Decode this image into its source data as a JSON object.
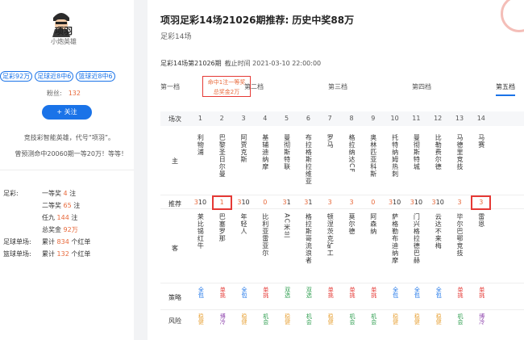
{
  "profile": {
    "nickname": "项羽",
    "subtitle": "小炮英雄",
    "tags": [
      "足彩92万",
      "足球近8中6",
      "篮球近8中6"
    ],
    "fans_label": "粉丝:",
    "fans_value": "132",
    "follow_label": "+ 关注",
    "desc_line1": "竞技彩智能英雄，代号“项羽”。",
    "desc_line2": "曾预测命中20060期一等20万！等等！",
    "stats": [
      {
        "label": "足彩:",
        "prefix": "一等奖",
        "num": "4",
        "suffix": "注"
      },
      {
        "label": "",
        "prefix": "二等奖",
        "num": "65",
        "suffix": "注"
      },
      {
        "label": "",
        "prefix": "任九",
        "num": "144",
        "suffix": "注"
      },
      {
        "label": "",
        "prefix": "总奖金",
        "num": "92万",
        "suffix": ""
      },
      {
        "label": "足球单场:",
        "prefix": "累计",
        "num": "834",
        "suffix": "个红单"
      },
      {
        "label": "篮球单场:",
        "prefix": "累计",
        "num": "132",
        "suffix": "个红单"
      }
    ]
  },
  "article": {
    "title": "项羽足彩14场21026期推荐: 历史中奖88万",
    "subtitle": "足彩14场",
    "issue": "足彩14场第21026期",
    "deadline": "截止时间 2021-03-10 22:00:00",
    "tiers": [
      "第一档",
      "第二档",
      "第三档",
      "第四档",
      "第五档"
    ],
    "note_line1": "命中1注一等奖",
    "note_line2": "总奖金2万"
  },
  "table": {
    "header_label": "场次",
    "home_label": "主",
    "rec_label": "推荐",
    "away_label": "客",
    "strategy_label": "策略",
    "risk_label": "风险",
    "numbers": [
      "1",
      "2",
      "3",
      "4",
      "5",
      "6",
      "7",
      "8",
      "9",
      "10",
      "11",
      "12",
      "13",
      "14"
    ],
    "home": [
      "利物浦",
      "巴黎圣日尔曼",
      "阿贾克斯",
      "基辅迪纳摩",
      "曼彻斯特联",
      "布拉格斯拉维亚",
      "罗马",
      "格拉纳达CF",
      "奥林匹亚科斯",
      "托特纳姆热刺",
      "曼彻斯特城",
      "比勒费尔德",
      "马德里竞技",
      "马赛"
    ],
    "rec": [
      {
        "main": "3",
        "extra": "1",
        "tail": "0"
      },
      {
        "main": "1",
        "extra": "",
        "tail": ""
      },
      {
        "main": "3",
        "extra": "1",
        "tail": "0"
      },
      {
        "main": "0",
        "extra": "",
        "tail": ""
      },
      {
        "main": "3",
        "extra": "1",
        "tail": ""
      },
      {
        "main": "3",
        "extra": "1",
        "tail": ""
      },
      {
        "main": "3",
        "extra": "",
        "tail": ""
      },
      {
        "main": "3",
        "extra": "",
        "tail": ""
      },
      {
        "main": "0",
        "extra": "",
        "tail": ""
      },
      {
        "main": "3",
        "extra": "1",
        "tail": "0"
      },
      {
        "main": "3",
        "extra": "1",
        "tail": "0"
      },
      {
        "main": "3",
        "extra": "1",
        "tail": "0"
      },
      {
        "main": "3",
        "extra": "",
        "tail": ""
      },
      {
        "main": "3",
        "extra": "",
        "tail": ""
      }
    ],
    "away": [
      "莱比锡红牛",
      "巴塞罗那",
      "年轻人",
      "比利亚雷亚尔",
      "AC米兰",
      "格拉斯哥流浪者",
      "顿涅茨克矿工",
      "莫尔德",
      "阿森纳",
      "萨格勒布迪纳摩",
      "门兴格拉德巴赫",
      "云达不来梅",
      "毕尔巴鄂竞技",
      "雷恩"
    ],
    "strategy": [
      {
        "text": "全包",
        "color": "#1a73e8"
      },
      {
        "text": "单挑",
        "color": "#e53935"
      },
      {
        "text": "全包",
        "color": "#1a73e8"
      },
      {
        "text": "单挑",
        "color": "#e53935"
      },
      {
        "text": "双选",
        "color": "#2e9e4f"
      },
      {
        "text": "双选",
        "color": "#2e9e4f"
      },
      {
        "text": "单挑",
        "color": "#e53935"
      },
      {
        "text": "单挑",
        "color": "#e53935"
      },
      {
        "text": "单挑",
        "color": "#e53935"
      },
      {
        "text": "全包",
        "color": "#1a73e8"
      },
      {
        "text": "全包",
        "color": "#1a73e8"
      },
      {
        "text": "全包",
        "color": "#1a73e8"
      },
      {
        "text": "单挑",
        "color": "#e53935"
      },
      {
        "text": "单挑",
        "color": "#e53935"
      }
    ],
    "risk": [
      {
        "text": "稳健",
        "color": "#e8a43c"
      },
      {
        "text": "博冷",
        "color": "#8e44ad"
      },
      {
        "text": "稳健",
        "color": "#e8a43c"
      },
      {
        "text": "机会",
        "color": "#2e9e4f"
      },
      {
        "text": "稳健",
        "color": "#e8a43c"
      },
      {
        "text": "机会",
        "color": "#2e9e4f"
      },
      {
        "text": "稳健",
        "color": "#e8a43c"
      },
      {
        "text": "机会",
        "color": "#2e9e4f"
      },
      {
        "text": "机会",
        "color": "#2e9e4f"
      },
      {
        "text": "稳健",
        "color": "#e8a43c"
      },
      {
        "text": "稳健",
        "color": "#e8a43c"
      },
      {
        "text": "稳健",
        "color": "#e8a43c"
      },
      {
        "text": "机会",
        "color": "#2e9e4f"
      },
      {
        "text": "博冷",
        "color": "#8e44ad"
      }
    ]
  },
  "colors": {
    "accent": "#1a73e8",
    "highlight": "#e86a3c",
    "red": "#e53935"
  }
}
